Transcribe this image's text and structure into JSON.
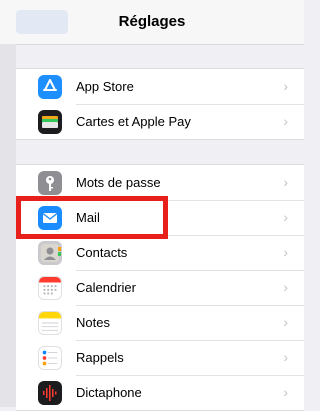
{
  "nav": {
    "title": "Réglages"
  },
  "group1": [
    {
      "label": "App Store",
      "icon": "app-store-icon",
      "color": "#1e8fff"
    },
    {
      "label": "Cartes et Apple Pay",
      "icon": "wallet-icon",
      "color": "#1d1d1f"
    }
  ],
  "group2": [
    {
      "label": "Mots de passe",
      "icon": "key-icon",
      "color": "#8e8e93"
    },
    {
      "label": "Mail",
      "icon": "mail-icon",
      "color": "#1a8cff"
    },
    {
      "label": "Contacts",
      "icon": "contacts-icon",
      "color": "#c9c9ce"
    },
    {
      "label": "Calendrier",
      "icon": "calendar-icon",
      "color": "#ffffff"
    },
    {
      "label": "Notes",
      "icon": "notes-icon",
      "color": "#ffd60a"
    },
    {
      "label": "Rappels",
      "icon": "reminders-icon",
      "color": "#ffffff"
    },
    {
      "label": "Dictaphone",
      "icon": "voice-memos-icon",
      "color": "#1c1c1e"
    }
  ],
  "chevron": "›"
}
